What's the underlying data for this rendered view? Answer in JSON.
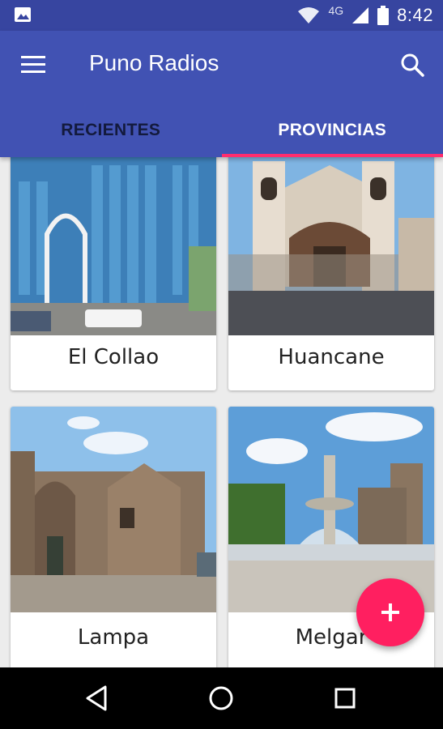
{
  "status_bar": {
    "network": "4G",
    "time": "8:42",
    "icons": [
      "image-icon",
      "wifi-icon",
      "signal-icon",
      "battery-icon"
    ]
  },
  "app_bar": {
    "title": "Puno Radios",
    "menu_icon": "hamburger-menu-icon",
    "search_icon": "search-icon"
  },
  "tabs": [
    {
      "label": "RECIENTES",
      "active": false
    },
    {
      "label": "PROVINCIAS",
      "active": true
    }
  ],
  "provinces": [
    {
      "name": "El Collao"
    },
    {
      "name": "Huancane"
    },
    {
      "name": "Lampa"
    },
    {
      "name": "Melgar"
    }
  ],
  "fab": {
    "icon": "plus-icon"
  },
  "nav_bar": {
    "icons": [
      "back-icon",
      "home-icon",
      "recents-icon"
    ]
  },
  "colors": {
    "status_bar": "#3745a0",
    "app_bar": "#4152b3",
    "tab_indicator": "#ff2d6e",
    "fab": "#ff1f60"
  }
}
